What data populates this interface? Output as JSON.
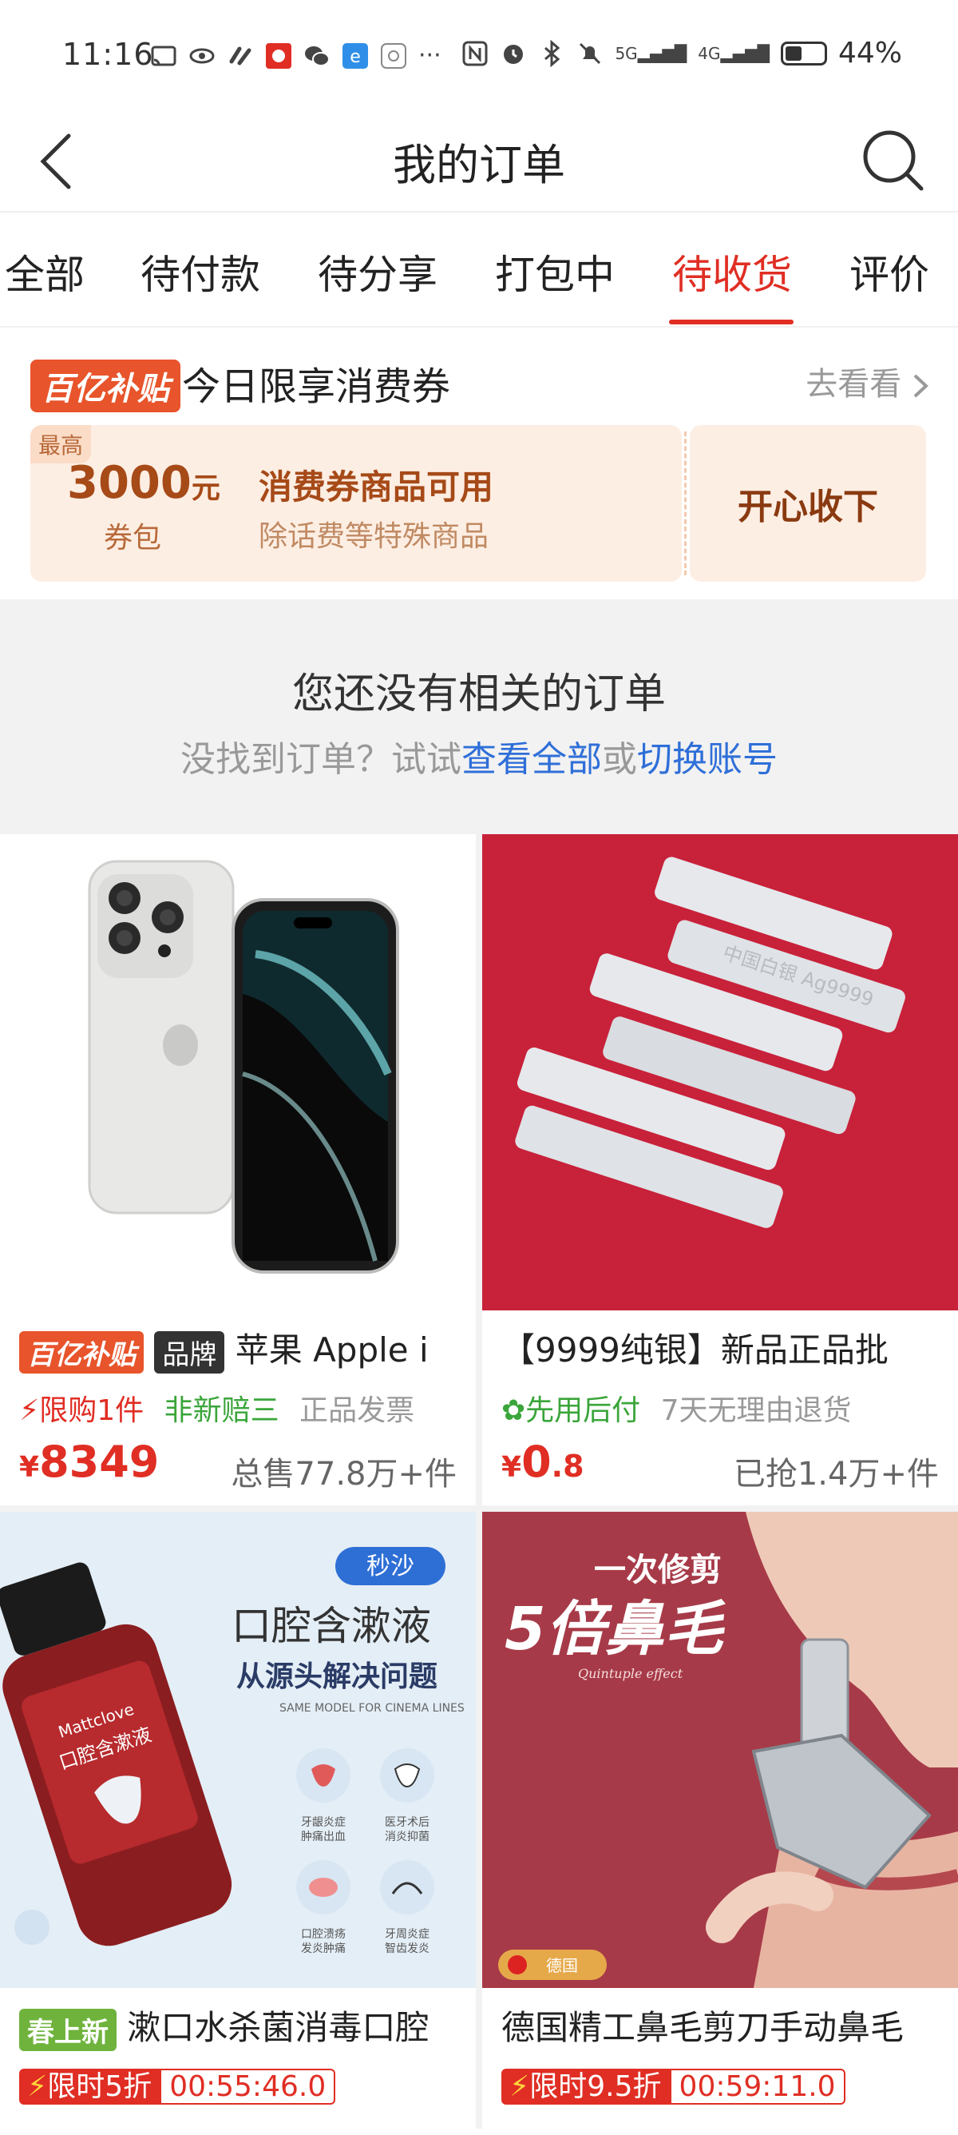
{
  "status_bar": {
    "time": "11:16",
    "battery": "44%",
    "network_labels": [
      "5G",
      "4G"
    ]
  },
  "nav": {
    "title": "我的订单"
  },
  "tabs": [
    {
      "label": "全部"
    },
    {
      "label": "待付款"
    },
    {
      "label": "待分享"
    },
    {
      "label": "打包中"
    },
    {
      "label": "待收货",
      "active": true
    },
    {
      "label": "评价"
    }
  ],
  "coupon": {
    "badge": "百亿补贴",
    "title": "今日限享消费券",
    "goto": "去看看",
    "max_label": "最高",
    "amount": "3000",
    "amount_unit": "元",
    "pack_label": "券包",
    "line1": "消费券商品可用",
    "line2": "除话费等特殊商品",
    "accept": "开心收下"
  },
  "empty": {
    "title": "您还没有相关的订单",
    "hint_prefix": "没找到订单？试试",
    "link_all": "查看全部",
    "or": "或",
    "link_switch": "切换账号"
  },
  "products": [
    {
      "badge": "百亿补贴",
      "brand_badge": "品牌",
      "name": "苹果 Apple i",
      "tag1": "限购1件",
      "tag2": "非新赔三",
      "tag3": "正品发票",
      "price_symbol": "¥",
      "price": "8349",
      "sold": "总售77.8万+件"
    },
    {
      "name": "【9999纯银】新品正品批",
      "tag1": "先用后付",
      "tag2": "7天无理由退货",
      "price_symbol": "¥",
      "price_int": "0",
      "price_dec": ".8",
      "sold": "已抢1.4万+件",
      "image_text": "中国白银 Ag9999"
    },
    {
      "badge": "春上新",
      "name": "漱口水杀菌消毒口腔",
      "flash": "限时5折",
      "timer": "00:55:46.0",
      "image_tag": "秒沙",
      "image_title": "口腔含漱液",
      "image_subtitle": "从源头解决问题",
      "image_en": "SAME MODEL FOR CINEMA LINES",
      "bottle_label": "口腔含漱液",
      "bottle_brand": "Mattclove",
      "features": [
        "牙龈炎症\n肿痛出血",
        "医牙术后\n消炎抑菌",
        "口腔溃疡\n发炎肿痛",
        "牙周炎症\n智齿发炎"
      ]
    },
    {
      "name": "德国精工鼻毛剪刀手动鼻毛",
      "flash": "限时9.5折",
      "timer": "00:59:11.0",
      "image_line1": "一次修剪",
      "image_line2": "5倍鼻毛",
      "image_en": "Quintuple effect",
      "image_badge": "德国"
    }
  ],
  "colors": {
    "accent": "#e02e24",
    "coupon_bg": "#fdeee3",
    "link": "#2f6fd8",
    "green": "#3aa53a"
  }
}
